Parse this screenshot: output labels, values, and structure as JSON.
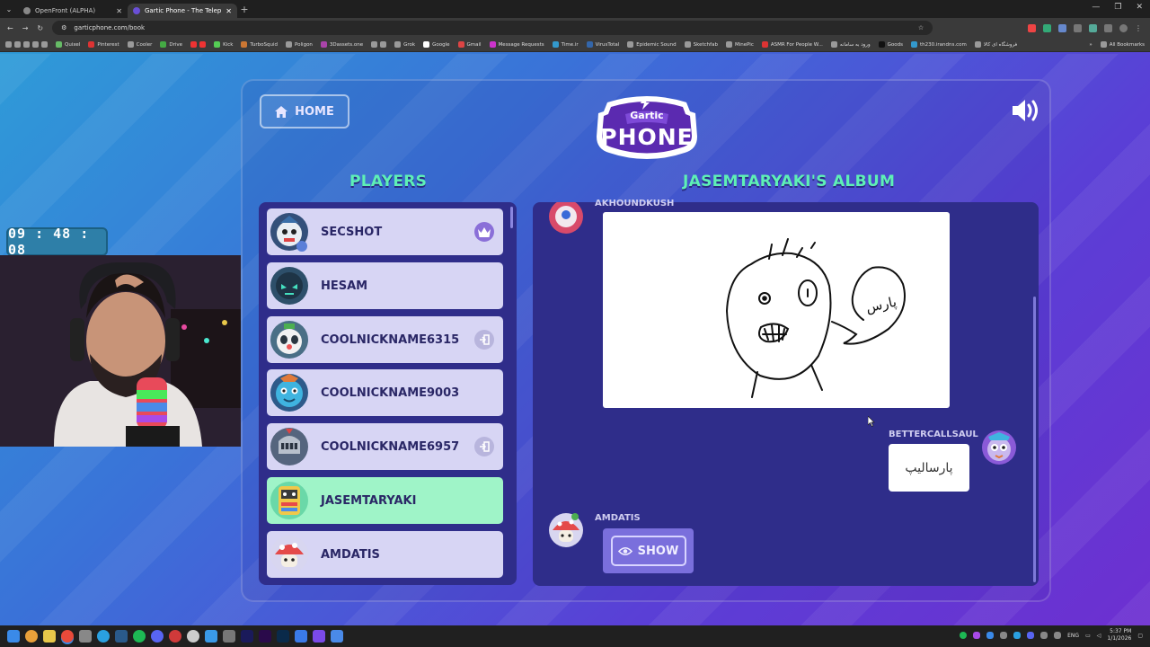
{
  "browser": {
    "tabs": [
      {
        "title": "OpenFront (ALPHA)",
        "active": false
      },
      {
        "title": "Gartic Phone - The Telephone G",
        "active": true
      }
    ],
    "url": "garticphone.com/book",
    "bookmarks": [
      "Quixel",
      "Pinterest",
      "Cooler",
      "Drive",
      "Kick",
      "TurboSquid",
      "Poligon",
      "3Dassets.one",
      "Grok",
      "Google",
      "Gmail",
      "Message Requests",
      "Time.ir",
      "VirusTotal",
      "Epidemic Sound",
      "Sketchfab",
      "MinePic",
      "ASMR For People W...",
      "ورود به سامانه",
      "Goods",
      "th230.irandns.com",
      "فروشگاه ای کالا"
    ],
    "all_bookmarks_label": "All Bookmarks"
  },
  "game": {
    "home_label": "HOME",
    "logo_text_top": "Gartic",
    "logo_text_bottom": "PHONE",
    "players_heading": "PLAYERS",
    "album_heading": "JASEMTARYAKI'S ALBUM",
    "players": [
      {
        "name": "SECSHOT",
        "badge": "crown-icon",
        "active": false
      },
      {
        "name": "HESAM",
        "badge": "",
        "active": false
      },
      {
        "name": "COOLNICKNAME6315",
        "badge": "exit-icon",
        "active": false
      },
      {
        "name": "COOLNICKNAME9003",
        "badge": "",
        "active": false
      },
      {
        "name": "COOLNICKNAME6957",
        "badge": "exit-icon",
        "active": false
      },
      {
        "name": "JASEMTARYAKI",
        "badge": "",
        "active": true
      },
      {
        "name": "AMDATIS",
        "badge": "",
        "active": false
      }
    ],
    "album": {
      "top_author": "AKHOUNDKUSH",
      "drawing_text": "پارس",
      "guess_author": "BETTERCALLSAUL",
      "guess_text": "پارسالیپ",
      "pending_author": "AMDATIS",
      "show_label": "SHOW"
    },
    "colors": {
      "accent_green": "#5ef0b6",
      "active_row": "#9ff4c8",
      "panel": "#2f2d8a"
    }
  },
  "stream": {
    "timer": "09 : 48 : 08"
  },
  "taskbar": {
    "language": "ENG",
    "time": "5:37 PM",
    "date": "1/1/2026"
  }
}
